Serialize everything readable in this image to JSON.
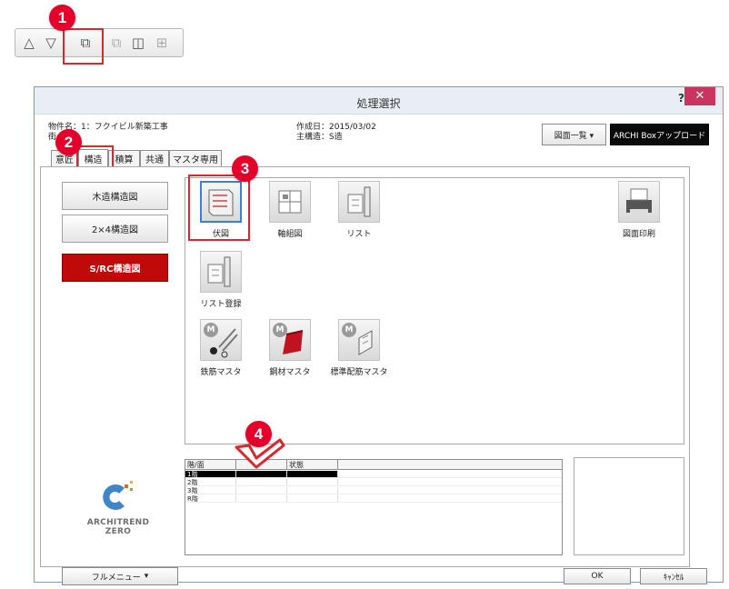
{
  "toolbar": {
    "buttons": [
      {
        "icon": "triangle-up-icon",
        "glyph": "△"
      },
      {
        "icon": "triangle-down-icon",
        "glyph": "▽"
      },
      {
        "icon": "window-icon",
        "glyph": "⧉"
      },
      {
        "icon": "window-disabled-icon",
        "glyph": "⧉"
      },
      {
        "icon": "split-vertical-icon",
        "glyph": "◫"
      },
      {
        "icon": "grid-icon",
        "glyph": "⊞"
      }
    ]
  },
  "callouts": [
    "1",
    "2",
    "3",
    "4"
  ],
  "dialog": {
    "title": "処理選択",
    "help": "?",
    "close": "✕",
    "property_label": "物件名：1：フクイビル新築工事",
    "property_label2": "街",
    "created": "作成日：2015/03/02",
    "structure": "主構造：S造",
    "drawing_list_button": "図面一覧 ▾",
    "upload_button": "ARCHI Boxアップロード",
    "tabs": [
      "意匠",
      "構造",
      "積算",
      "共通",
      "マスタ専用"
    ],
    "active_tab": "構造",
    "side_menu": [
      "木造構造図",
      "2×4構造図",
      "S/RC構造図"
    ],
    "active_side": "S/RC構造図",
    "tools": [
      {
        "label": "伏図",
        "icon": "framing-plan-icon"
      },
      {
        "label": "軸組図",
        "icon": "axis-frame-icon"
      },
      {
        "label": "リスト",
        "icon": "list-icon"
      },
      {
        "label": "図面印刷",
        "icon": "printer-icon"
      },
      {
        "label": "リスト登録",
        "icon": "list-register-icon"
      },
      {
        "label": "鉄筋マスタ",
        "icon": "rebar-master-icon"
      },
      {
        "label": "鋼材マスタ",
        "icon": "steel-master-icon"
      },
      {
        "label": "標準配筋マスタ",
        "icon": "standard-rebar-master-icon"
      }
    ],
    "floor_table": {
      "headers": [
        "階/面",
        "",
        "状態"
      ],
      "rows": [
        "1階",
        "2階",
        "3階",
        "R階"
      ],
      "selected": "1階"
    },
    "logo_line1": "ARCHITREND",
    "logo_line2": "ZERO",
    "full_menu": "フルメニュー",
    "ok": "OK",
    "cancel": "ｷｬﾝｾﾙ"
  },
  "colors": {
    "accent_red": "#e4002b",
    "active_side": "#c00a0a",
    "title_close": "#c8365d",
    "selection_blue": "#3c7fd6"
  }
}
